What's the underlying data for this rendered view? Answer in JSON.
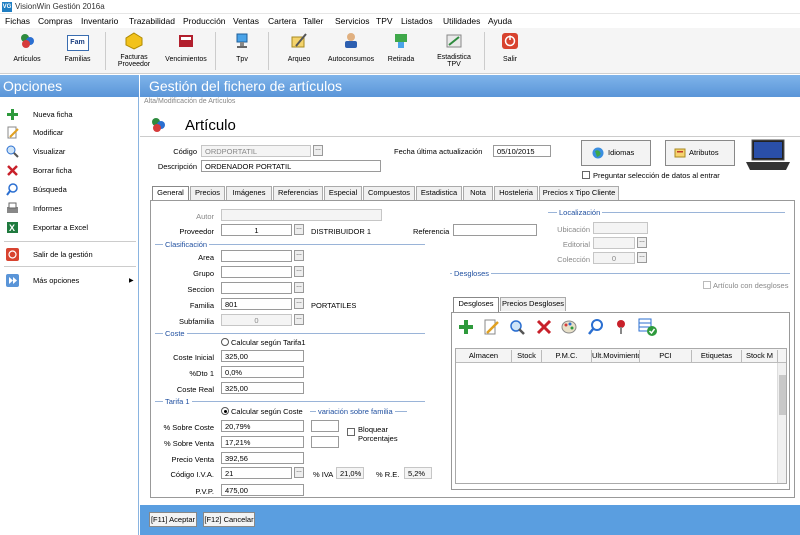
{
  "window": {
    "title": "VisionWin Gestión 2016a",
    "app_badge": "VG"
  },
  "menu": [
    "Fichas",
    "Compras",
    "Inventario",
    "Trazabilidad",
    "Producción",
    "Ventas",
    "Cartera",
    "Taller",
    "Servicios",
    "TPV",
    "Listados",
    "Utilidades",
    "Ayuda"
  ],
  "toolbar": [
    {
      "label": "Artículos",
      "icon": "articles-icon"
    },
    {
      "label": "Familias",
      "icon": "families-icon",
      "badge": "Fam"
    },
    {
      "label": "Facturas\nProveedor",
      "icon": "supplier-invoices-icon"
    },
    {
      "label": "Vencimientos",
      "icon": "due-dates-icon"
    },
    {
      "label": "Tpv",
      "icon": "pos-icon"
    },
    {
      "label": "Arqueo",
      "icon": "cash-count-icon"
    },
    {
      "label": "Autoconsumos",
      "icon": "self-consumption-icon"
    },
    {
      "label": "Retirada",
      "icon": "withdrawal-icon"
    },
    {
      "label": "Estadistica\nTPV",
      "icon": "pos-statistics-icon"
    },
    {
      "label": "Salir",
      "icon": "exit-icon"
    }
  ],
  "sidebar": {
    "title": "Opciones",
    "items": [
      "Nueva ficha",
      "Modificar",
      "Visualizar",
      "Borrar ficha",
      "Búsqueda",
      "Informes",
      "Exportar a Excel"
    ],
    "exit": "Salir de la gestión",
    "more": "Más opciones",
    "more_arrow": "▶"
  },
  "main": {
    "title": "Gestión del fichero de artículos",
    "subtitle": "Alta/Modificación de Artículos",
    "heading": "Artículo"
  },
  "header": {
    "codigo_label": "Código",
    "codigo": "ORDPORTATIL",
    "descripcion_label": "Descripción",
    "descripcion": "ORDENADOR PORTATIL",
    "fecha_label": "Fecha última actualización",
    "fecha": "05/10/2015",
    "idiomas": "Idiomas",
    "atributos": "Atributos",
    "preguntar": "Preguntar selección de datos al entrar"
  },
  "tabs": [
    "General",
    "Precios",
    "Imágenes",
    "Referencias",
    "Especial",
    "Compuestos",
    "Estadistica",
    "Nota",
    "Hosteleria",
    "Precios x Tipo Cliente"
  ],
  "general": {
    "autor_label": "Autor",
    "autor": "",
    "proveedor_label": "Proveedor",
    "proveedor": "1",
    "proveedor_name": "DISTRIBUIDOR 1",
    "referencia_label": "Referencia",
    "referencia": "",
    "clasificacion": "Clasificación",
    "area_label": "Area",
    "grupo_label": "Grupo",
    "seccion_label": "Seccion",
    "familia_label": "Familia",
    "familia": "801",
    "familia_name": "PORTATILES",
    "subfamilia_label": "Subfamilia",
    "subfamilia": "0",
    "coste": "Coste",
    "calc_tarifa": "Calcular según Tarifa1",
    "coste_inicial_label": "Coste Inicial",
    "coste_inicial": "325,00",
    "dto_label": "%Dto 1",
    "dto": "0,0%",
    "coste_real_label": "Coste Real",
    "coste_real": "325,00",
    "tarifa": "Tarifa 1",
    "calc_coste": "Calcular según Coste",
    "variacion": "variación sobre familia",
    "sobre_coste_label": "% Sobre Coste",
    "sobre_coste": "20,79%",
    "sobre_venta_label": "% Sobre Venta",
    "sobre_venta": "17,21%",
    "bloquear": "Bloquear\nPorcentajes",
    "precio_venta_label": "Precio Venta",
    "precio_venta": "392,56",
    "iva_code_label": "Código I.V.A.",
    "iva_code": "21",
    "iva_label": "% IVA",
    "iva": "21,0%",
    "re_label": "% R.E.",
    "re": "5,2%",
    "pvp_label": "P.V.P.",
    "pvp": "475,00"
  },
  "localizacion": {
    "title": "Localización",
    "ubicacion_label": "Ubicación",
    "editorial_label": "Editorial",
    "coleccion_label": "Colección",
    "coleccion": "0"
  },
  "desgloses": {
    "title": "Desgloses",
    "con_desgloses": "Artículo con desgloses",
    "tabs": [
      "Desgloses",
      "Precios Desgloses"
    ],
    "columns": [
      "Almacen",
      "Stock",
      "P.M.C.",
      "Ult.Movimiento",
      "PCI",
      "Etiquetas",
      "Stock M"
    ]
  },
  "footer": {
    "accept": "[F11] Aceptar",
    "cancel": "[F12] Cancelar"
  }
}
